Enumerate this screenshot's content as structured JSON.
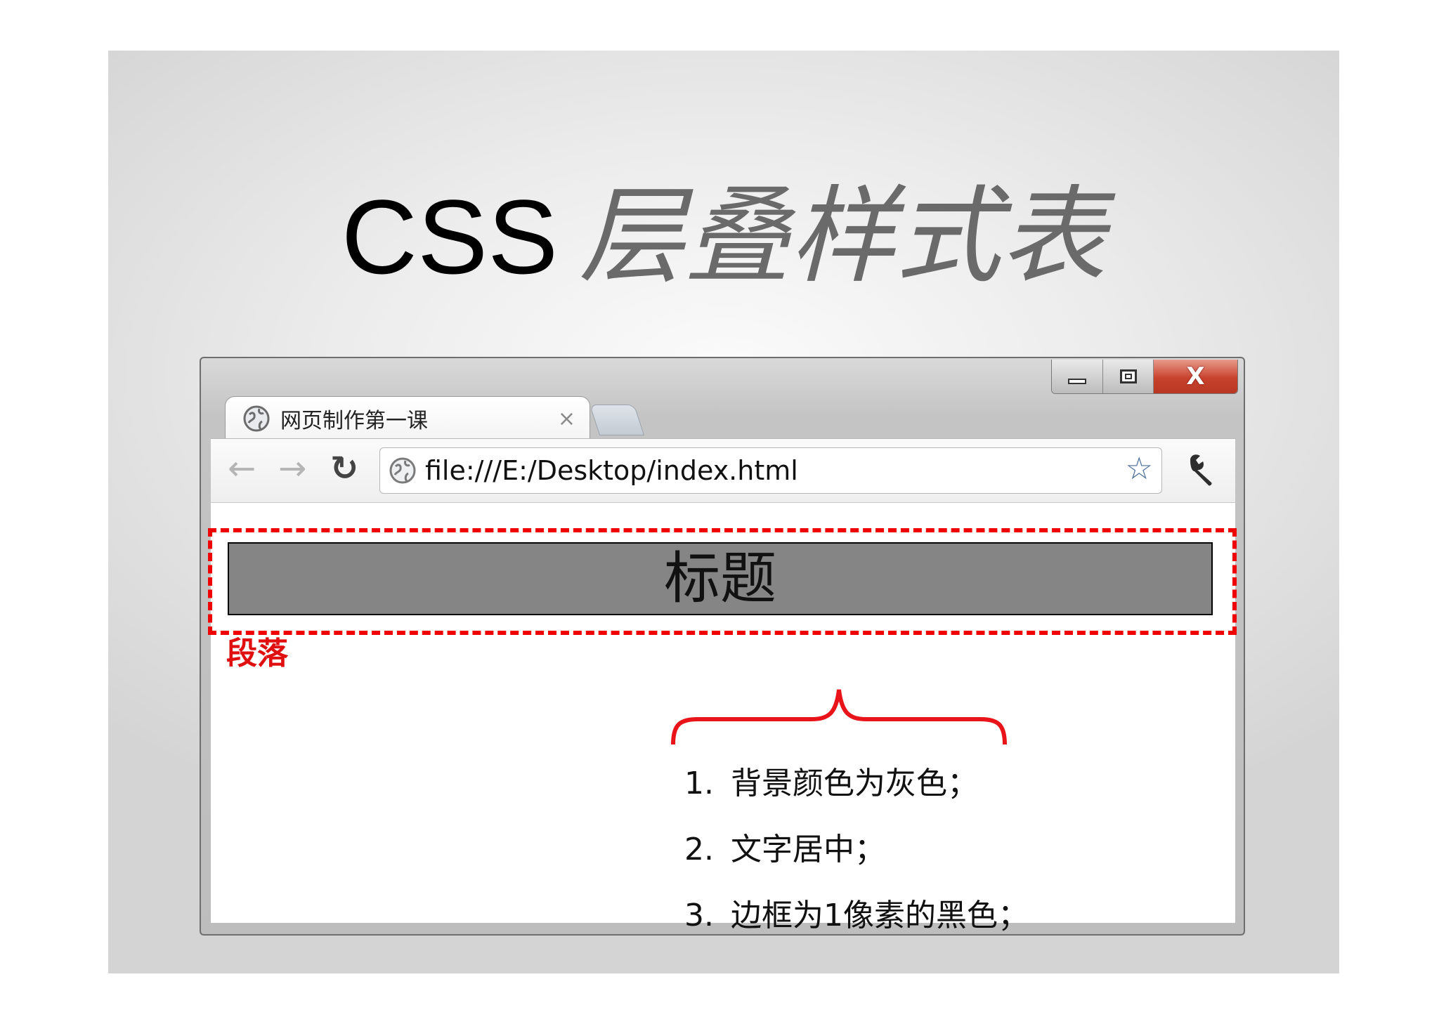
{
  "slide": {
    "title_latin": "CSS",
    "title_chinese": "层叠样式表"
  },
  "browser": {
    "window_controls": {
      "close_glyph": "X"
    },
    "tab": {
      "label": "网页制作第一课",
      "close_glyph": "×"
    },
    "toolbar": {
      "back_glyph": "←",
      "forward_glyph": "→",
      "reload_glyph": "↻",
      "url": "file:///E:/Desktop/index.html",
      "bookmark_glyph": "☆"
    },
    "page": {
      "heading": "标题",
      "paragraph": "段落"
    }
  },
  "annotations": {
    "outline_color": "#f00000",
    "requirements": [
      {
        "num": "1.",
        "text": "背景颜色为灰色；"
      },
      {
        "num": "2.",
        "text": "文字居中；"
      },
      {
        "num": "3.",
        "text": "边框为1像素的黑色；"
      }
    ]
  }
}
